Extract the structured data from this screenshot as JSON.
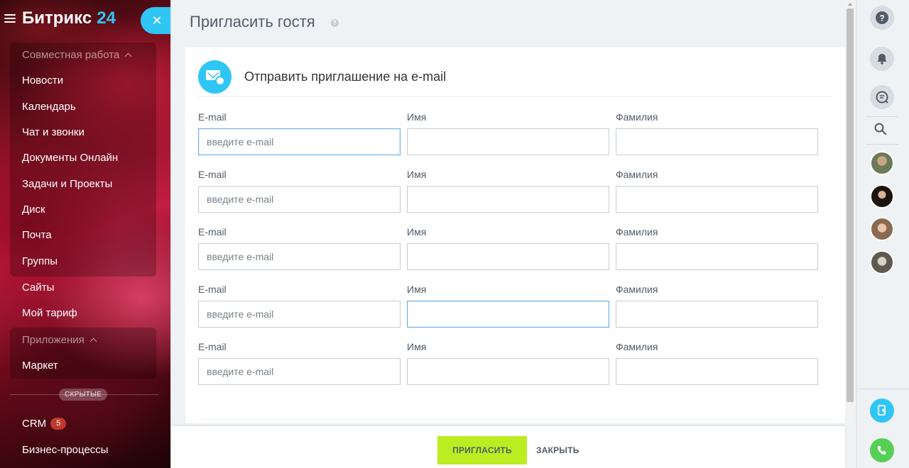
{
  "sidebar": {
    "brand": "Битрикс",
    "brand_number": "24",
    "collab_group": "Совместная работа",
    "items": [
      {
        "label": "Новости"
      },
      {
        "label": "Календарь"
      },
      {
        "label": "Чат и звонки"
      },
      {
        "label": "Документы Онлайн"
      },
      {
        "label": "Задачи и Проекты"
      },
      {
        "label": "Диск"
      },
      {
        "label": "Почта"
      },
      {
        "label": "Группы"
      },
      {
        "label": "Сайты"
      },
      {
        "label": "Мой тариф"
      }
    ],
    "apps_group": "Приложения",
    "apps_items": [
      {
        "label": "Маркет"
      }
    ],
    "hidden_label": "СКРЫТЫЕ",
    "crm_label": "CRM",
    "crm_count": "5",
    "bp_label": "Бизнес-процессы",
    "accent_color": "#2fc6f6"
  },
  "panel": {
    "title": "Пригласить гостя",
    "help": "?",
    "card_title": "Отправить приглашение на e-mail",
    "rows": [
      {
        "email_label": "E-mail",
        "email_placeholder": "введите e-mail",
        "name_label": "Имя",
        "surname_label": "Фамилия",
        "focused": "email"
      },
      {
        "email_label": "E-mail",
        "email_placeholder": "введите e-mail",
        "name_label": "Имя",
        "surname_label": "Фамилия",
        "focused": ""
      },
      {
        "email_label": "E-mail",
        "email_placeholder": "введите e-mail",
        "name_label": "Имя",
        "surname_label": "Фамилия",
        "focused": ""
      },
      {
        "email_label": "E-mail",
        "email_placeholder": "введите e-mail",
        "name_label": "Имя",
        "surname_label": "Фамилия",
        "focused": "name"
      },
      {
        "email_label": "E-mail",
        "email_placeholder": "введите e-mail",
        "name_label": "Имя",
        "surname_label": "Фамилия",
        "focused": ""
      }
    ],
    "invite_button": "ПРИГЛАСИТЬ",
    "close_button": "ЗАКРЫТЬ",
    "invite_color": "#bbed21"
  },
  "rail": {
    "icons": [
      "help-icon",
      "bell-icon",
      "chat-icon",
      "search-icon"
    ],
    "avatars": [
      "avatar-user-1",
      "avatar-user-2",
      "avatar-user-3",
      "avatar-user-4"
    ],
    "bottom_icons": [
      "phone-book-icon",
      "phone-icon"
    ]
  }
}
